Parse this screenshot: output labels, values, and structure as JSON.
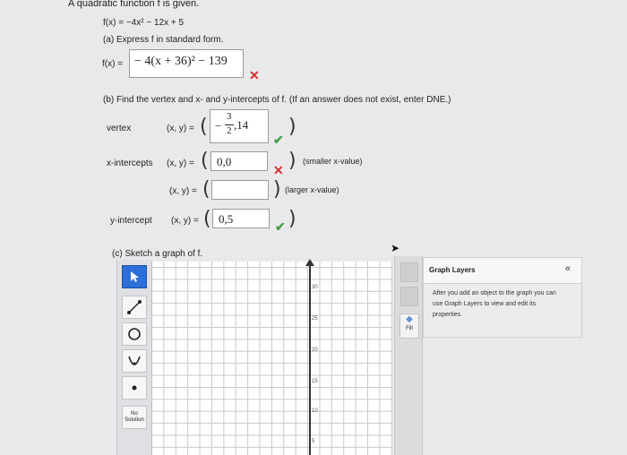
{
  "intro": "A quadratic function f is given.",
  "function_def": "f(x) = −4x² − 12x + 5",
  "part_a": {
    "prompt": "(a) Express f in standard form.",
    "label": "f(x) =",
    "answer": "− 4(x + 36)² − 139",
    "status": "incorrect"
  },
  "part_b": {
    "prompt": "(b) Find the vertex and x- and y-intercepts of f. (If an answer does not exist, enter DNE.)",
    "vertex_label": "vertex",
    "xy_label": "(x, y) =",
    "vertex_answer_x_num": "3",
    "vertex_answer_x_den": "2",
    "vertex_answer_neg": "−",
    "vertex_answer_y": ",14",
    "vertex_status": "correct",
    "xint_label": "x-intercepts",
    "xint1_answer": "0,0",
    "xint1_status": "incorrect",
    "xint1_note": "(smaller x-value)",
    "xint2_answer": "",
    "xint2_note": "(larger x-value)",
    "yint_label": "y-intercept",
    "yint_answer": "0,5",
    "yint_status": "correct"
  },
  "part_c": {
    "prompt": "(c) Sketch a graph of f.",
    "tools": [
      "pointer-tool",
      "line-tool",
      "circle-tool",
      "parabola-tool",
      "point-tool",
      "no-solution-tool"
    ],
    "no_solution_label": "No Solution",
    "y_tick_labels": [
      "30",
      "25",
      "20",
      "15",
      "10",
      "5"
    ],
    "fill_label": "Fill",
    "graph_layers_title": "Graph Layers",
    "collapse_symbol": "«",
    "graph_layers_help": "After you add an object to the graph you can use Graph Layers to view and edit its properties."
  },
  "colors": {
    "correct": "#43a047",
    "incorrect": "#d32f2f",
    "active_tool": "#2d6fd8",
    "page_bg": "#e9e9ec"
  }
}
